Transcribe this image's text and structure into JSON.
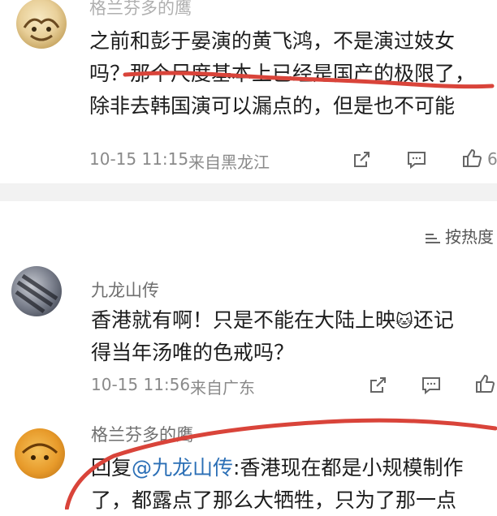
{
  "comments": [
    {
      "username": "格兰芬多的鹰",
      "lines": [
        "之前和彭于晏演的黄飞鸿，不是演过妓女",
        "吗？那个尺度基本上已经是国产的极限了，",
        "除非去韩国演可以漏点的，但是也不可能"
      ],
      "time": "10-15 11:15",
      "location": "来自黑龙江",
      "likes": "6"
    },
    {
      "username": "九龙山传",
      "lines": [
        "香港就有啊！只是不能在大陆上映",
        "还记",
        "得当年汤唯的色戒吗？"
      ],
      "emoji": "🐱",
      "time": "10-15 11:56",
      "location": "来自广东"
    },
    {
      "username": "格兰芬多的鹰",
      "reply_prefix": "回复",
      "mention": "@九龙山传",
      "lines": [
        ":香港现在都是小规模制作",
        "了，都露点了那么大牺牲，只为了那一点"
      ]
    }
  ],
  "sort": {
    "label": "按热度"
  },
  "icons": {
    "share": "share-icon",
    "comment": "comment-icon",
    "like": "thumbs-up-icon",
    "sort": "sort-icon"
  },
  "colors": {
    "annotation_red": "#d9443a",
    "mention_blue": "#2b6fb6"
  }
}
